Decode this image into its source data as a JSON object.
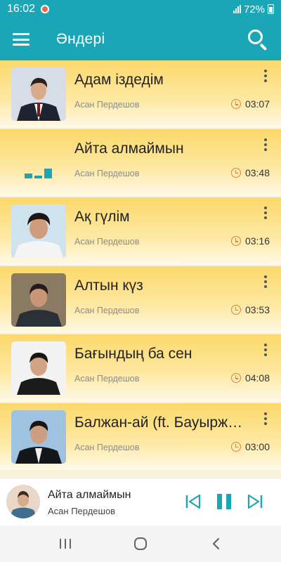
{
  "status_bar": {
    "time": "16:02",
    "battery": "72%"
  },
  "app_bar": {
    "title": "Әндері"
  },
  "songs": [
    {
      "title": "Адам іздедім",
      "artist": "Асан Пердешов",
      "duration": "03:07",
      "thumb": "face-a"
    },
    {
      "title": "Айта алмаймын",
      "artist": "Асан Пердешов",
      "duration": "03:48",
      "thumb": "equalizer"
    },
    {
      "title": "Ақ гүлім",
      "artist": "Асан Пердешов",
      "duration": "03:16",
      "thumb": "face-b"
    },
    {
      "title": "Алтын күз",
      "artist": "Асан Пердешов",
      "duration": "03:53",
      "thumb": "face-c"
    },
    {
      "title": "Бағындың ба сен",
      "artist": "Асан Пердешов",
      "duration": "04:08",
      "thumb": "face-d"
    },
    {
      "title": "Балжан-ай (ft. Бауыржан Ахметов)",
      "artist": "Асан Пердешов",
      "duration": "03:00",
      "thumb": "face-e"
    }
  ],
  "now_playing": {
    "title": "Айта алмаймын",
    "artist": "Асан Пердешов",
    "state": "playing"
  },
  "colors": {
    "accent": "#1aa6b7",
    "row_gradient_top": "#fcd86a",
    "clock": "#e0833a"
  }
}
